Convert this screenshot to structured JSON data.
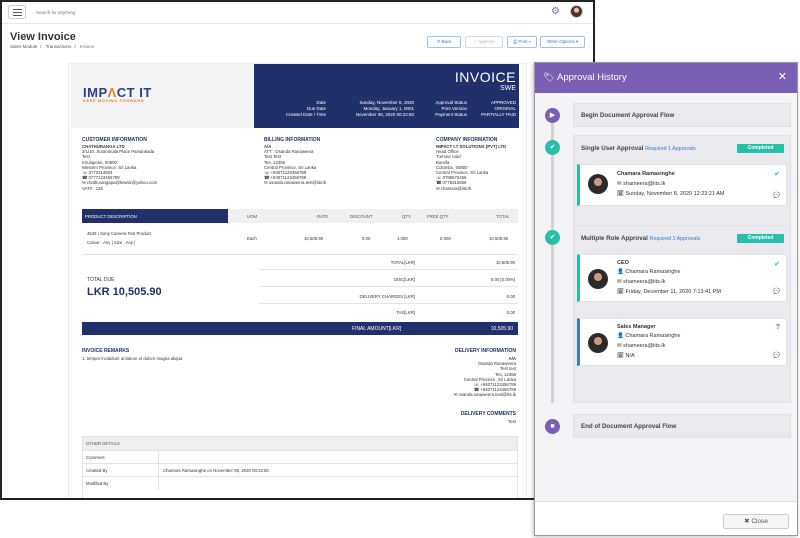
{
  "topbar": {
    "search_placeholder": "Search for anything",
    "gear_icon": "gear-icon",
    "avatar_icon": "user-avatar"
  },
  "page": {
    "title": "View Invoice",
    "breadcrumbs": [
      "Sales Module",
      "Transactions",
      "Invoice"
    ],
    "toolbar": {
      "back": "⟲ Back",
      "approve": "✓ Approve",
      "print": "⎙ Print ▾",
      "other": "Other Options ▾"
    }
  },
  "invoice": {
    "logo": {
      "main_a": "IMP",
      "main_b": "CT IT",
      "accent": "Λ",
      "tagline": "KEEP MOVING FORWARD"
    },
    "title": "INVOICE",
    "subtitle": "SWE",
    "header_labels": [
      "Date",
      "Due Date",
      "Created Date / Time"
    ],
    "header_values": [
      "Sunday, November 8, 2020",
      "Monday, January 1, 0001",
      "November 08, 2020 00:22:50"
    ],
    "status_labels": [
      "Approval Status",
      "Print Version",
      "Payment Status"
    ],
    "status_values": [
      "APPROVED",
      "ORIGINAL",
      "PARTIALLY PAID"
    ],
    "customer": {
      "heading": "CUSTOMER INFORMATION",
      "name": "CHATHURANGA LTD",
      "lines": [
        "3/1/10, Suranimala Place Pamankada",
        "Test",
        "Kirulapone, 00600",
        "Western Province, Sri Lanka",
        "☏  0773314604",
        "☎  0777123456789",
        "✉  chathurangapa@lewalz@yahoo.com",
        "VAT# : 125"
      ]
    },
    "billing": {
      "heading": "BILLING INFORMATION",
      "name": "A/A",
      "lines": [
        "ATT : Osanda Ranaweera",
        "Test Test",
        "Tes, 12356",
        "Central Province, Sri Lanka",
        "☏  +94071123456789",
        "☎  +94071123456789",
        "✉  osanda.ranaweera.test@iits.lk"
      ]
    },
    "company": {
      "heading": "COMPANY INFORMATION",
      "name": "IMPACT I.T SOLUTIONS (PVT) LTD",
      "lines": [
        "Head Office",
        "Turnour road",
        "Borella",
        "Colombo, 00800",
        "Central Province, Sri Lanka",
        "☏  0786676456",
        "☎  0776315556",
        "✉  chamara@iits.lk"
      ]
    },
    "table": {
      "headers": [
        "PRODUCT DESCRIPTION",
        "UOM",
        "RATE",
        "DISCOUNT",
        "QTY.",
        "FREE QTY.",
        "TOTAL"
      ],
      "rows": [
        {
          "desc": "4545 | Sony Camera Test Product",
          "desc2": "Colour : Any | Size : Any |",
          "uom": "Each",
          "rate": "10,505.90",
          "discount": "0.00",
          "qty": "1.000",
          "free": "0.000",
          "total": "10,505.90"
        }
      ]
    },
    "totals": {
      "total_label": "TOTAL[LKR]",
      "total_value": "10,505.90",
      "disc_label": "DISC[LKR]",
      "disc_value": "0.00 [0.00%]",
      "delivery_label": "DELIVERY CHARGES [LKR]",
      "delivery_value": "0.00",
      "tax_label": "TAX[LKR]",
      "tax_value": "0.00",
      "final_label": "FINAL AMOUNT[LKR]",
      "final_value": "10,505.90",
      "due_label": "TOTAL DUE",
      "due_value": "LKR 10,505.90"
    },
    "remarks": {
      "heading": "INVOICE REMARKS",
      "text": "1. tempor incididunt ut labore et dolore magna aliqua"
    },
    "delivery": {
      "heading": "DELIVERY INFORMATION",
      "name": "A/A",
      "lines": [
        "Osanda Ranaweera",
        "Test test",
        "Tes, 12356",
        "Central Province, Sri Lanka",
        "☏  +94071123456789",
        "☎  +94071123456789",
        "✉  osanda.ranaweera.test@iits.lk"
      ],
      "comments_heading": "DELIVERY COMMENTS",
      "comments_text": "Test"
    },
    "other_details": {
      "heading": "OTHER DETAILS",
      "rows": [
        {
          "label": "Comment",
          "value": ""
        },
        {
          "label": "Created By",
          "value": "Chamara Ramasinghe on November 08, 2020 00:22:50"
        },
        {
          "label": "Modified By",
          "value": ""
        }
      ]
    }
  },
  "approval_panel": {
    "title": "Approval History",
    "steps": {
      "begin": "Begin Document Approval Flow",
      "single": {
        "label": "Single User Approval",
        "req": "Required 1 Approvals",
        "badge": "Completed"
      },
      "multiple": {
        "label": "Multiple Role Approval",
        "req": "Required 1 Approvals",
        "badge": "Completed"
      },
      "end": "End of Document Approval Flow"
    },
    "cards": [
      {
        "role": "",
        "name": "Chamara Ramasinghe",
        "email": "shameera@iits.lk",
        "date": "Sunday, November 8, 2020 12:23:21 AM",
        "status": "✔"
      },
      {
        "role": "CEO",
        "name": "Chamara Ramasinghe",
        "email": "shameera@iits.lk",
        "date": "Friday, December 11, 2020 7:13:41 PM",
        "status": "✔"
      },
      {
        "role": "Sales Manager",
        "name": "Chamara Ramasinghe",
        "email": "shameera@iits.lk",
        "date": "N/A",
        "status": "?"
      }
    ],
    "close_label": "✖  Close"
  }
}
